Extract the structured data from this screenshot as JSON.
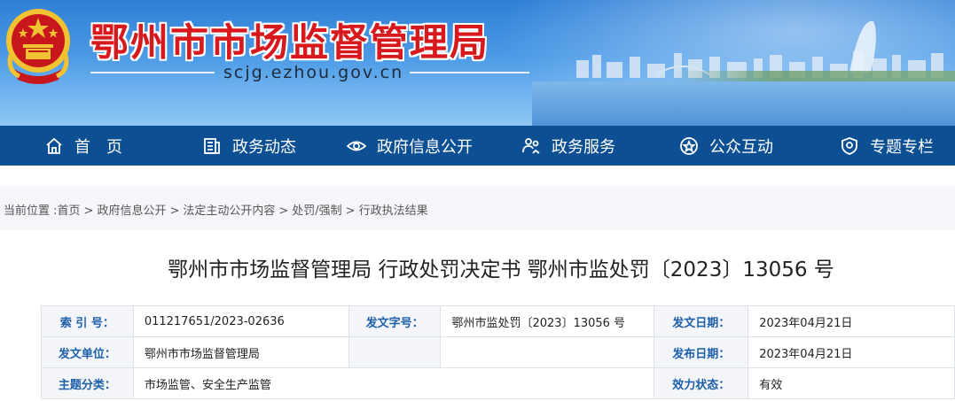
{
  "site": {
    "title": "鄂州市市场监督管理局",
    "domain": "scjg.ezhou.gov.cn"
  },
  "nav": [
    {
      "label": "首　页",
      "icon": "home-icon"
    },
    {
      "label": "政务动态",
      "icon": "news-icon"
    },
    {
      "label": "政府信息公开",
      "icon": "eye-icon"
    },
    {
      "label": "政务服务",
      "icon": "service-icon"
    },
    {
      "label": "公众互动",
      "icon": "interact-icon"
    },
    {
      "label": "专题专栏",
      "icon": "topic-icon"
    }
  ],
  "breadcrumb": {
    "prefix": "当前位置 :",
    "items": [
      "首页",
      "政府信息公开",
      "法定主动公开内容",
      "处罚/强制",
      "行政执法结果"
    ],
    "separator": ">"
  },
  "article": {
    "title": "鄂州市市场监督管理局 行政处罚决定书 鄂州市监处罚〔2023〕13056 号"
  },
  "meta": {
    "index_label": "索  引  号：",
    "index_value": "011217651/2023-02636",
    "doc_no_label": "发文字号：",
    "doc_no_value": "鄂州市监处罚〔2023〕13056 号",
    "issue_date_label": "发文日期：",
    "issue_date_value": "2023年04月21日",
    "issuer_label": "发文单位：",
    "issuer_value": "鄂州市市场监督管理局",
    "publish_date_label": "发布日期：",
    "publish_date_value": "2023年04月21日",
    "topic_label": "主题分类：",
    "topic_value": "市场监管、安全生产监管",
    "status_label": "效力状态：",
    "status_value": "有效"
  },
  "colors": {
    "nav_bg": "#0d4f93",
    "title_red": "#d7191d",
    "label_blue": "#1d5fa8"
  }
}
